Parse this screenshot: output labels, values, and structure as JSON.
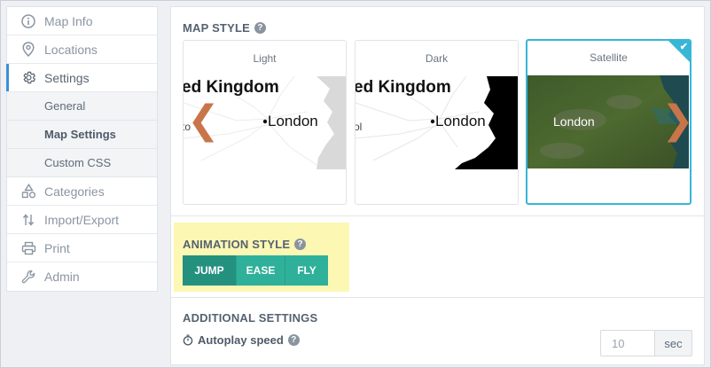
{
  "sidebar": {
    "items": [
      {
        "label": "Map Info",
        "icon": "info-icon"
      },
      {
        "label": "Locations",
        "icon": "map-pin-icon"
      },
      {
        "label": "Settings",
        "icon": "gear-icon"
      },
      {
        "label": "Categories",
        "icon": "shapes-icon"
      },
      {
        "label": "Import/Export",
        "icon": "import-export-icon"
      },
      {
        "label": "Print",
        "icon": "printer-icon"
      },
      {
        "label": "Admin",
        "icon": "wrench-icon"
      }
    ],
    "sub_items": [
      {
        "label": "General"
      },
      {
        "label": "Map Settings"
      },
      {
        "label": "Custom CSS"
      }
    ],
    "active_item": "Settings",
    "current_sub_item": "Map Settings"
  },
  "map_style": {
    "title": "MAP STYLE",
    "cards": [
      {
        "label": "Light",
        "map_text_country": "ed Kingdom",
        "map_text_city": "London",
        "map_text_edge": "to"
      },
      {
        "label": "Dark",
        "map_text_country": "ed Kingdom",
        "map_text_city": "London",
        "map_text_edge": "ol"
      },
      {
        "label": "Satellite",
        "map_text_city": "London"
      }
    ],
    "selected": "Satellite",
    "prev_arrow": "❮",
    "next_arrow": "❯"
  },
  "animation_style": {
    "title": "ANIMATION STYLE",
    "options": [
      "JUMP",
      "EASE",
      "FLY"
    ],
    "selected": "JUMP"
  },
  "additional_settings": {
    "title": "ADDITIONAL SETTINGS",
    "autoplay_label": "Autoplay speed",
    "autoplay_value": "10",
    "autoplay_unit": "sec"
  },
  "colors": {
    "accent_teal": "#2fb09a",
    "selected_border": "#37b6d6",
    "highlight_yellow": "#fdf7b4",
    "arrow": "#c8754a"
  }
}
